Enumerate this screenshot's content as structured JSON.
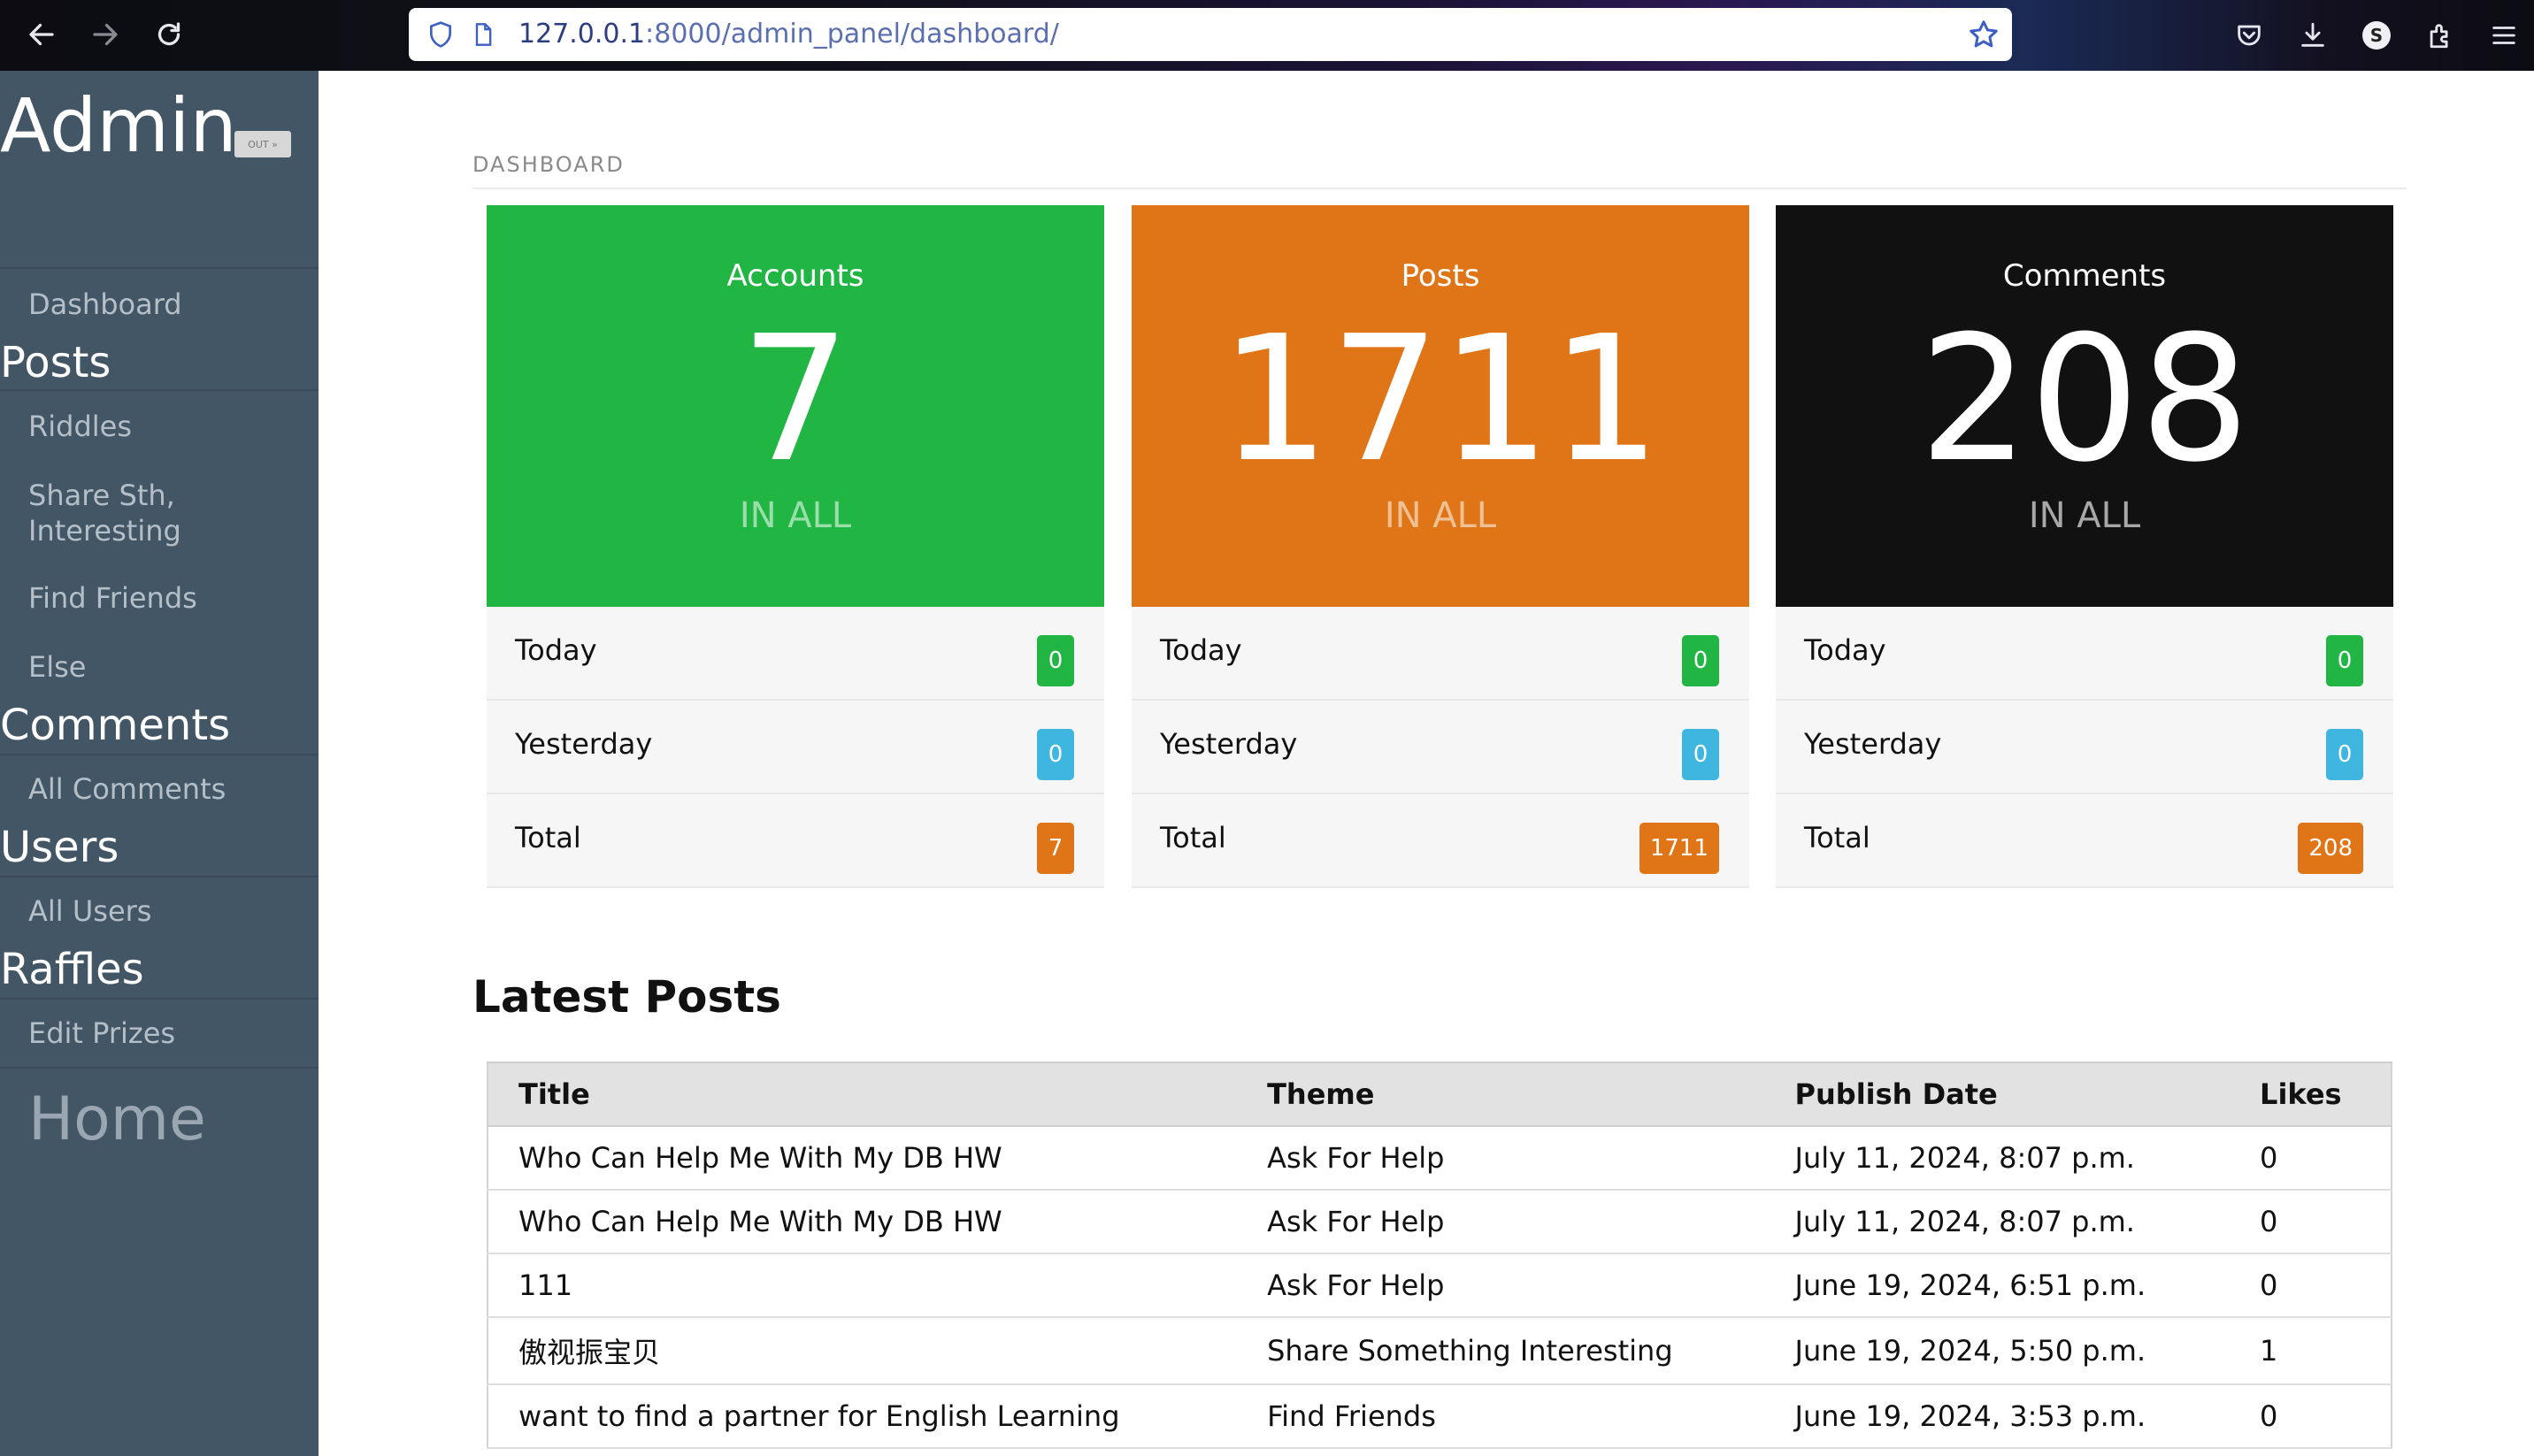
{
  "browser": {
    "url_host": "127.0.0.1",
    "url_rest": ":8000/admin_panel/dashboard/",
    "profile_initial": "S"
  },
  "sidebar": {
    "brand": "Admin",
    "brand_badge": "OUT »",
    "dashboard": "Dashboard",
    "sections": [
      {
        "title": "Posts",
        "items": [
          "Riddles",
          "Share Sth, Interesting",
          "Find Friends",
          "Else"
        ]
      },
      {
        "title": "Comments",
        "items": [
          "All Comments"
        ]
      },
      {
        "title": "Users",
        "items": [
          "All Users"
        ]
      },
      {
        "title": "Raffles",
        "items": [
          "Edit Prizes"
        ]
      }
    ],
    "home": "Home"
  },
  "dashboard": {
    "title": "DASHBOARD",
    "cards": [
      {
        "label": "Accounts",
        "value": "7",
        "sub": "IN ALL",
        "color": "#21b544",
        "rows": [
          {
            "label": "Today",
            "value": "0"
          },
          {
            "label": "Yesterday",
            "value": "0"
          },
          {
            "label": "Total",
            "value": "7"
          }
        ]
      },
      {
        "label": "Posts",
        "value": "1711",
        "sub": "IN ALL",
        "color": "#e07518",
        "rows": [
          {
            "label": "Today",
            "value": "0"
          },
          {
            "label": "Yesterday",
            "value": "0"
          },
          {
            "label": "Total",
            "value": "1711"
          }
        ]
      },
      {
        "label": "Comments",
        "value": "208",
        "sub": "IN ALL",
        "color": "#111111",
        "rows": [
          {
            "label": "Today",
            "value": "0"
          },
          {
            "label": "Yesterday",
            "value": "0"
          },
          {
            "label": "Total",
            "value": "208"
          }
        ]
      }
    ],
    "badge_colors": {
      "today": "#21b544",
      "yesterday": "#3fb6e0",
      "total": "#e07518"
    }
  },
  "latest_posts": {
    "title": "Latest Posts",
    "columns": [
      "Title",
      "Theme",
      "Publish Date",
      "Likes"
    ],
    "rows": [
      [
        "Who Can Help Me With My DB HW",
        "Ask For Help",
        "July 11, 2024, 8:07 p.m.",
        "0"
      ],
      [
        "Who Can Help Me With My DB HW",
        "Ask For Help",
        "July 11, 2024, 8:07 p.m.",
        "0"
      ],
      [
        "111",
        "Ask For Help",
        "June 19, 2024, 6:51 p.m.",
        "0"
      ],
      [
        "傲视振宝贝",
        "Share Something Interesting",
        "June 19, 2024, 5:50 p.m.",
        "1"
      ],
      [
        "want to find a partner for English Learning",
        "Find Friends",
        "June 19, 2024, 3:53 p.m.",
        "0"
      ]
    ]
  }
}
